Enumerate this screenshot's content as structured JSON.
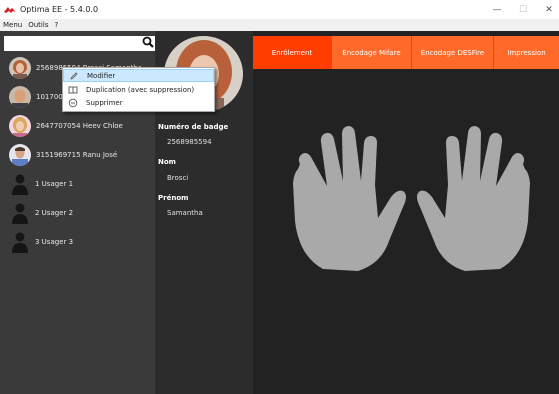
{
  "window": {
    "title": "Optima EE - 5.4.0.0",
    "minimize_glyph": "—",
    "maximize_glyph": "☐",
    "close_glyph": "✕"
  },
  "menu": [
    "Menu",
    "Outils",
    "?"
  ],
  "search": {
    "value": "",
    "icon": "search-icon"
  },
  "users": [
    {
      "id": "2568985594",
      "text": "2568985594   Brosci   Samantha",
      "avatar": "woman-redhead",
      "selected": true
    },
    {
      "id": "1017008",
      "text": "1017008",
      "avatar": "man-bald"
    },
    {
      "id": "2647707054",
      "text": "2647707054   Heev   Chloe",
      "avatar": "woman-blonde"
    },
    {
      "id": "3151969715",
      "text": "3151969715   Ranu   José",
      "avatar": "man-shirt"
    },
    {
      "id": "1",
      "text": "1   Usager 1",
      "avatar": "silhouette"
    },
    {
      "id": "2",
      "text": "2   Usager 2",
      "avatar": "silhouette"
    },
    {
      "id": "3",
      "text": "3   Usager 3",
      "avatar": "silhouette"
    }
  ],
  "details": {
    "badge_label": "Numéro de badge",
    "badge_value": "2568985594",
    "nom_label": "Nom",
    "nom_value": "Brosci",
    "prenom_label": "Prénom",
    "prenom_value": "Samantha"
  },
  "tabs": [
    {
      "label": "Enrôlement",
      "active": true
    },
    {
      "label": "Encodage Mifare",
      "active": false
    },
    {
      "label": "Encodage DESFire",
      "active": false
    },
    {
      "label": "Impression",
      "active": false
    }
  ],
  "context_menu": [
    {
      "label": "Modifier",
      "icon": "pencil-icon",
      "highlighted": true
    },
    {
      "label": "Duplication (avec suppression)",
      "icon": "duplicate-icon",
      "highlighted": false
    },
    {
      "label": "Supprimer",
      "icon": "minus-circle-icon",
      "highlighted": false
    }
  ],
  "colors": {
    "tab_active": "#ff3d00",
    "tab_inactive": "#ff6a2a",
    "hand": "#a9a9a9",
    "highlight": "#cce8ff"
  }
}
